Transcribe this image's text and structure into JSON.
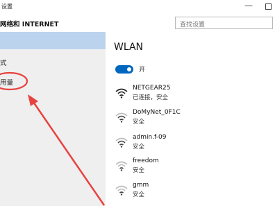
{
  "window": {
    "title": "设置"
  },
  "header": {
    "section": "网络和 INTERNET"
  },
  "search": {
    "placeholder": "查找设置"
  },
  "sidebar": {
    "items": [
      {
        "label": "式"
      },
      {
        "label": "用量"
      }
    ]
  },
  "wlan": {
    "title": "WLAN",
    "toggle_label": "开",
    "networks": [
      {
        "ssid": "NETGEAR25",
        "status": "已连接，安全"
      },
      {
        "ssid": "DoMyNet_0F1C",
        "status": "安全"
      },
      {
        "ssid": "admin.f-09",
        "status": "安全"
      },
      {
        "ssid": "freedom",
        "status": "安全"
      },
      {
        "ssid": "gmm",
        "status": "安全"
      }
    ]
  },
  "colors": {
    "accent": "#0067c0",
    "selection": "#bcd3ee",
    "sidebar_bg": "#efefef",
    "annotation": "#e8423f"
  },
  "icons": {
    "wifi": "wifi-icon",
    "minimize": "minimize-icon",
    "maximize": "maximize-icon"
  }
}
